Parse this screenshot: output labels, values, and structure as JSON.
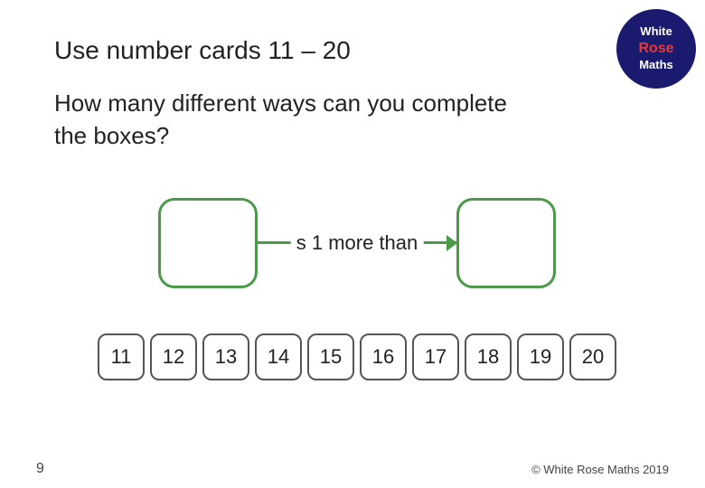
{
  "logo": {
    "line1": "White",
    "line2": "Rose",
    "line3": "Maths"
  },
  "title": "Use number cards 11 – 20",
  "subtitle_line1": "How many different ways can you complete",
  "subtitle_line2": "the boxes?",
  "connector_text": "s 1 more than",
  "number_cards": [
    "11",
    "12",
    "13",
    "14",
    "15",
    "16",
    "17",
    "18",
    "19",
    "20"
  ],
  "footer": {
    "page_number": "9",
    "copyright": "© White Rose Maths 2019"
  }
}
